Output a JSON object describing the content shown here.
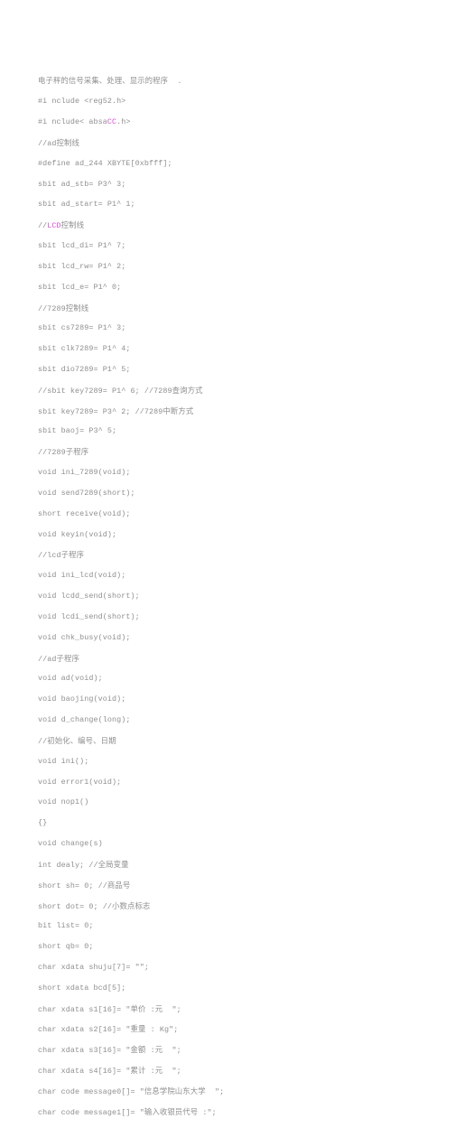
{
  "document": {
    "title": "电子秤的信号采集、处理、显示的程序",
    "background_color": "#ffffff",
    "text_color": "#8f8f8f",
    "highlight_color": "#d34fd3",
    "language": "C (8051 / Keil)",
    "lines": [
      {
        "text": "电子秤的信号采集、处理、显示的程序  ."
      },
      {
        "text": "#i nclude <reg52.h>"
      },
      {
        "pre": "#i nclude< absa",
        "hl": "CC",
        "post": ".h>"
      },
      {
        "text": "//ad控制线"
      },
      {
        "text": "#define ad_244 XBYTE[0xbfff];"
      },
      {
        "text": "sbit ad_stb= P3^ 3;"
      },
      {
        "text": "sbit ad_start= P1^ 1;"
      },
      {
        "pre": "//",
        "hl": "LCD",
        "post": "控制线"
      },
      {
        "text": "sbit lcd_di= P1^ 7;"
      },
      {
        "text": "sbit lcd_rw= P1^ 2;"
      },
      {
        "text": "sbit lcd_e= P1^ 0;"
      },
      {
        "text": "//7289控制线"
      },
      {
        "text": "sbit cs7289= P1^ 3;"
      },
      {
        "text": "sbit clk7289= P1^ 4;"
      },
      {
        "text": "sbit dio7289= P1^ 5;"
      },
      {
        "text": "//sbit key7289= P1^ 6; //7289查询方式"
      },
      {
        "text": "sbit key7289= P3^ 2; //7289中断方式"
      },
      {
        "text": "sbit baoj= P3^ 5;"
      },
      {
        "text": "//7289子程序"
      },
      {
        "text": "void ini_7289(void);"
      },
      {
        "text": "void send7289(short);"
      },
      {
        "text": "short receive(void);"
      },
      {
        "text": "void keyin(void);"
      },
      {
        "text": "//lcd子程序"
      },
      {
        "text": "void ini_lcd(void);"
      },
      {
        "text": "void lcdd_send(short);"
      },
      {
        "text": "void lcdi_send(short);"
      },
      {
        "text": "void chk_busy(void);"
      },
      {
        "text": "//ad子程序"
      },
      {
        "text": "void ad(void);"
      },
      {
        "text": "void baojing(void);"
      },
      {
        "text": "void d_change(long);"
      },
      {
        "text": "//初始化、编号、日期"
      },
      {
        "text": "void ini();"
      },
      {
        "text": "void error1(void);"
      },
      {
        "text": "void nop1()"
      },
      {
        "text": "{}"
      },
      {
        "text": "void change(s)"
      },
      {
        "text": "int dealy; //全局变量"
      },
      {
        "text": "short sh= 0; //商品号"
      },
      {
        "text": "short dot= 0; //小数点标志"
      },
      {
        "text": "bit list= 0;"
      },
      {
        "text": "short qb= 0;"
      },
      {
        "text": "char xdata shuju[7]= \"\";"
      },
      {
        "text": "short xdata bcd[5];"
      },
      {
        "text": "char xdata s1[16]= \"单价 :元  \";"
      },
      {
        "text": "char xdata s2[16]= \"重量 : Kg\";"
      },
      {
        "text": "char xdata s3[16]= \"金额 :元  \";"
      },
      {
        "text": "char xdata s4[16]= \"累计 :元  \";"
      },
      {
        "text": "char code message0[]= \"信息学院山东大学  \";"
      },
      {
        "text": "char code message1[]= \"输入收银员代号 :\";"
      }
    ]
  }
}
